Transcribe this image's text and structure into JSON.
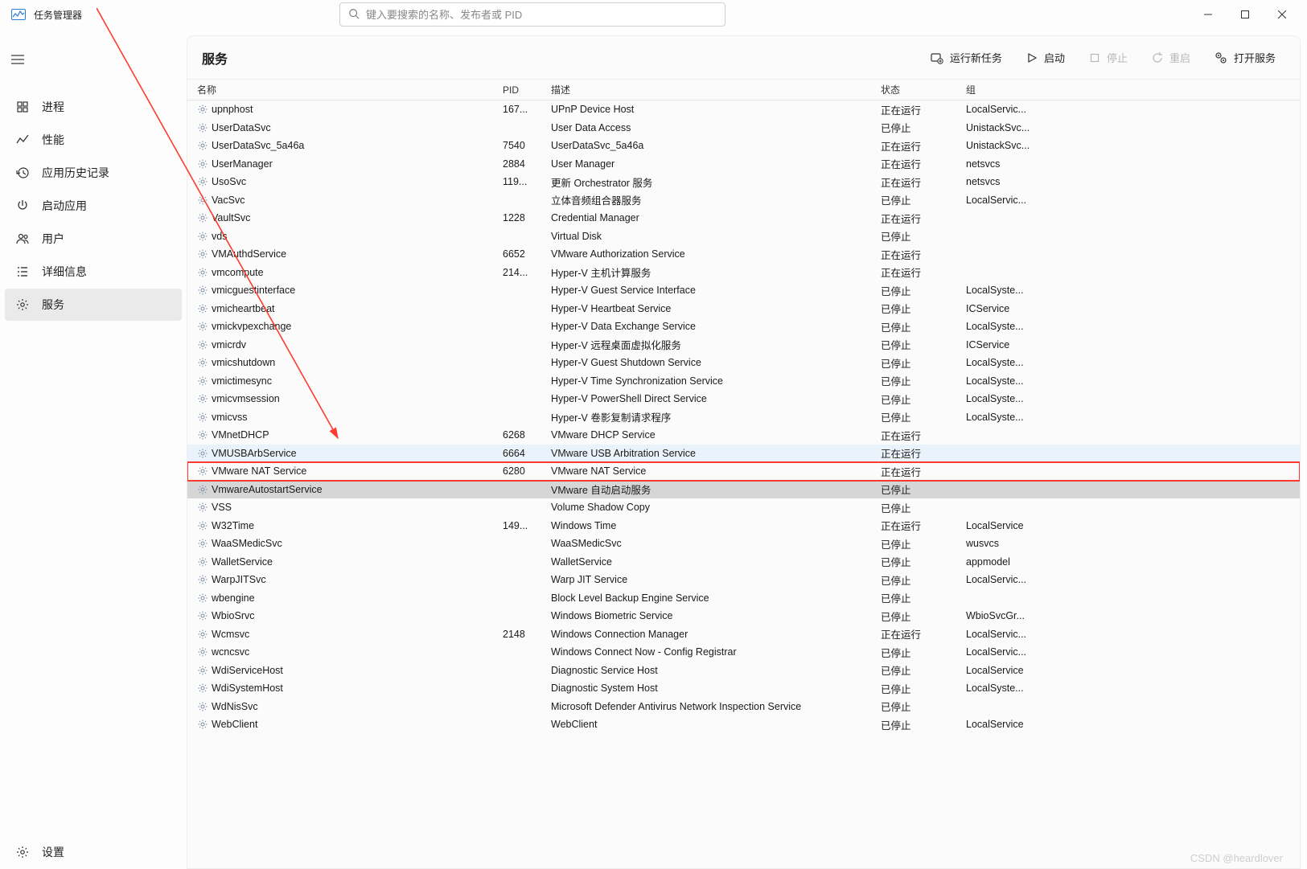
{
  "app": {
    "title": "任务管理器"
  },
  "search": {
    "placeholder": "键入要搜索的名称、发布者或 PID"
  },
  "sidebar": {
    "items": [
      {
        "icon": "processes",
        "label": "进程"
      },
      {
        "icon": "performance",
        "label": "性能"
      },
      {
        "icon": "history",
        "label": "应用历史记录"
      },
      {
        "icon": "startup",
        "label": "启动应用"
      },
      {
        "icon": "users",
        "label": "用户"
      },
      {
        "icon": "details",
        "label": "详细信息"
      },
      {
        "icon": "services",
        "label": "服务",
        "selected": true
      }
    ],
    "settings": {
      "label": "设置"
    }
  },
  "page": {
    "title": "服务",
    "actions": {
      "newtask": "运行新任务",
      "start": "启动",
      "stop": "停止",
      "restart": "重启",
      "open": "打开服务"
    },
    "columns": {
      "name": "名称",
      "pid": "PID",
      "desc": "描述",
      "status": "状态",
      "group": "组"
    }
  },
  "services": [
    {
      "name": "upnphost",
      "pid": "167...",
      "desc": "UPnP Device Host",
      "status": "正在运行",
      "group": "LocalServic..."
    },
    {
      "name": "UserDataSvc",
      "pid": "",
      "desc": "User Data Access",
      "status": "已停止",
      "group": "UnistackSvc..."
    },
    {
      "name": "UserDataSvc_5a46a",
      "pid": "7540",
      "desc": "UserDataSvc_5a46a",
      "status": "正在运行",
      "group": "UnistackSvc..."
    },
    {
      "name": "UserManager",
      "pid": "2884",
      "desc": "User Manager",
      "status": "正在运行",
      "group": "netsvcs"
    },
    {
      "name": "UsoSvc",
      "pid": "119...",
      "desc": "更新 Orchestrator 服务",
      "status": "正在运行",
      "group": "netsvcs"
    },
    {
      "name": "VacSvc",
      "pid": "",
      "desc": "立体音频组合器服务",
      "status": "已停止",
      "group": "LocalServic..."
    },
    {
      "name": "VaultSvc",
      "pid": "1228",
      "desc": "Credential Manager",
      "status": "正在运行",
      "group": ""
    },
    {
      "name": "vds",
      "pid": "",
      "desc": "Virtual Disk",
      "status": "已停止",
      "group": ""
    },
    {
      "name": "VMAuthdService",
      "pid": "6652",
      "desc": "VMware Authorization Service",
      "status": "正在运行",
      "group": ""
    },
    {
      "name": "vmcompute",
      "pid": "214...",
      "desc": "Hyper-V 主机计算服务",
      "status": "正在运行",
      "group": ""
    },
    {
      "name": "vmicguestinterface",
      "pid": "",
      "desc": "Hyper-V Guest Service Interface",
      "status": "已停止",
      "group": "LocalSyste..."
    },
    {
      "name": "vmicheartbeat",
      "pid": "",
      "desc": "Hyper-V Heartbeat Service",
      "status": "已停止",
      "group": "ICService"
    },
    {
      "name": "vmickvpexchange",
      "pid": "",
      "desc": "Hyper-V Data Exchange Service",
      "status": "已停止",
      "group": "LocalSyste..."
    },
    {
      "name": "vmicrdv",
      "pid": "",
      "desc": "Hyper-V 远程桌面虚拟化服务",
      "status": "已停止",
      "group": "ICService"
    },
    {
      "name": "vmicshutdown",
      "pid": "",
      "desc": "Hyper-V Guest Shutdown Service",
      "status": "已停止",
      "group": "LocalSyste..."
    },
    {
      "name": "vmictimesync",
      "pid": "",
      "desc": "Hyper-V Time Synchronization Service",
      "status": "已停止",
      "group": "LocalSyste..."
    },
    {
      "name": "vmicvmsession",
      "pid": "",
      "desc": "Hyper-V PowerShell Direct Service",
      "status": "已停止",
      "group": "LocalSyste..."
    },
    {
      "name": "vmicvss",
      "pid": "",
      "desc": "Hyper-V 卷影复制请求程序",
      "status": "已停止",
      "group": "LocalSyste..."
    },
    {
      "name": "VMnetDHCP",
      "pid": "6268",
      "desc": "VMware DHCP Service",
      "status": "正在运行",
      "group": ""
    },
    {
      "name": "VMUSBArbService",
      "pid": "6664",
      "desc": "VMware USB Arbitration Service",
      "status": "正在运行",
      "group": "",
      "hover": true
    },
    {
      "name": "VMware NAT Service",
      "pid": "6280",
      "desc": "VMware NAT Service",
      "status": "正在运行",
      "group": "",
      "highlighted": true
    },
    {
      "name": "VmwareAutostartService",
      "pid": "",
      "desc": "VMware 自动启动服务",
      "status": "已停止",
      "group": "",
      "selected": true
    },
    {
      "name": "VSS",
      "pid": "",
      "desc": "Volume Shadow Copy",
      "status": "已停止",
      "group": ""
    },
    {
      "name": "W32Time",
      "pid": "149...",
      "desc": "Windows Time",
      "status": "正在运行",
      "group": "LocalService"
    },
    {
      "name": "WaaSMedicSvc",
      "pid": "",
      "desc": "WaaSMedicSvc",
      "status": "已停止",
      "group": "wusvcs"
    },
    {
      "name": "WalletService",
      "pid": "",
      "desc": "WalletService",
      "status": "已停止",
      "group": "appmodel"
    },
    {
      "name": "WarpJITSvc",
      "pid": "",
      "desc": "Warp JIT Service",
      "status": "已停止",
      "group": "LocalServic..."
    },
    {
      "name": "wbengine",
      "pid": "",
      "desc": "Block Level Backup Engine Service",
      "status": "已停止",
      "group": ""
    },
    {
      "name": "WbioSrvc",
      "pid": "",
      "desc": "Windows Biometric Service",
      "status": "已停止",
      "group": "WbioSvcGr..."
    },
    {
      "name": "Wcmsvc",
      "pid": "2148",
      "desc": "Windows Connection Manager",
      "status": "正在运行",
      "group": "LocalServic..."
    },
    {
      "name": "wcncsvc",
      "pid": "",
      "desc": "Windows Connect Now - Config Registrar",
      "status": "已停止",
      "group": "LocalServic..."
    },
    {
      "name": "WdiServiceHost",
      "pid": "",
      "desc": "Diagnostic Service Host",
      "status": "已停止",
      "group": "LocalService"
    },
    {
      "name": "WdiSystemHost",
      "pid": "",
      "desc": "Diagnostic System Host",
      "status": "已停止",
      "group": "LocalSyste..."
    },
    {
      "name": "WdNisSvc",
      "pid": "",
      "desc": "Microsoft Defender Antivirus Network Inspection Service",
      "status": "已停止",
      "group": ""
    },
    {
      "name": "WebClient",
      "pid": "",
      "desc": "WebClient",
      "status": "已停止",
      "group": "LocalService"
    }
  ],
  "watermark": "CSDN @heardlover"
}
